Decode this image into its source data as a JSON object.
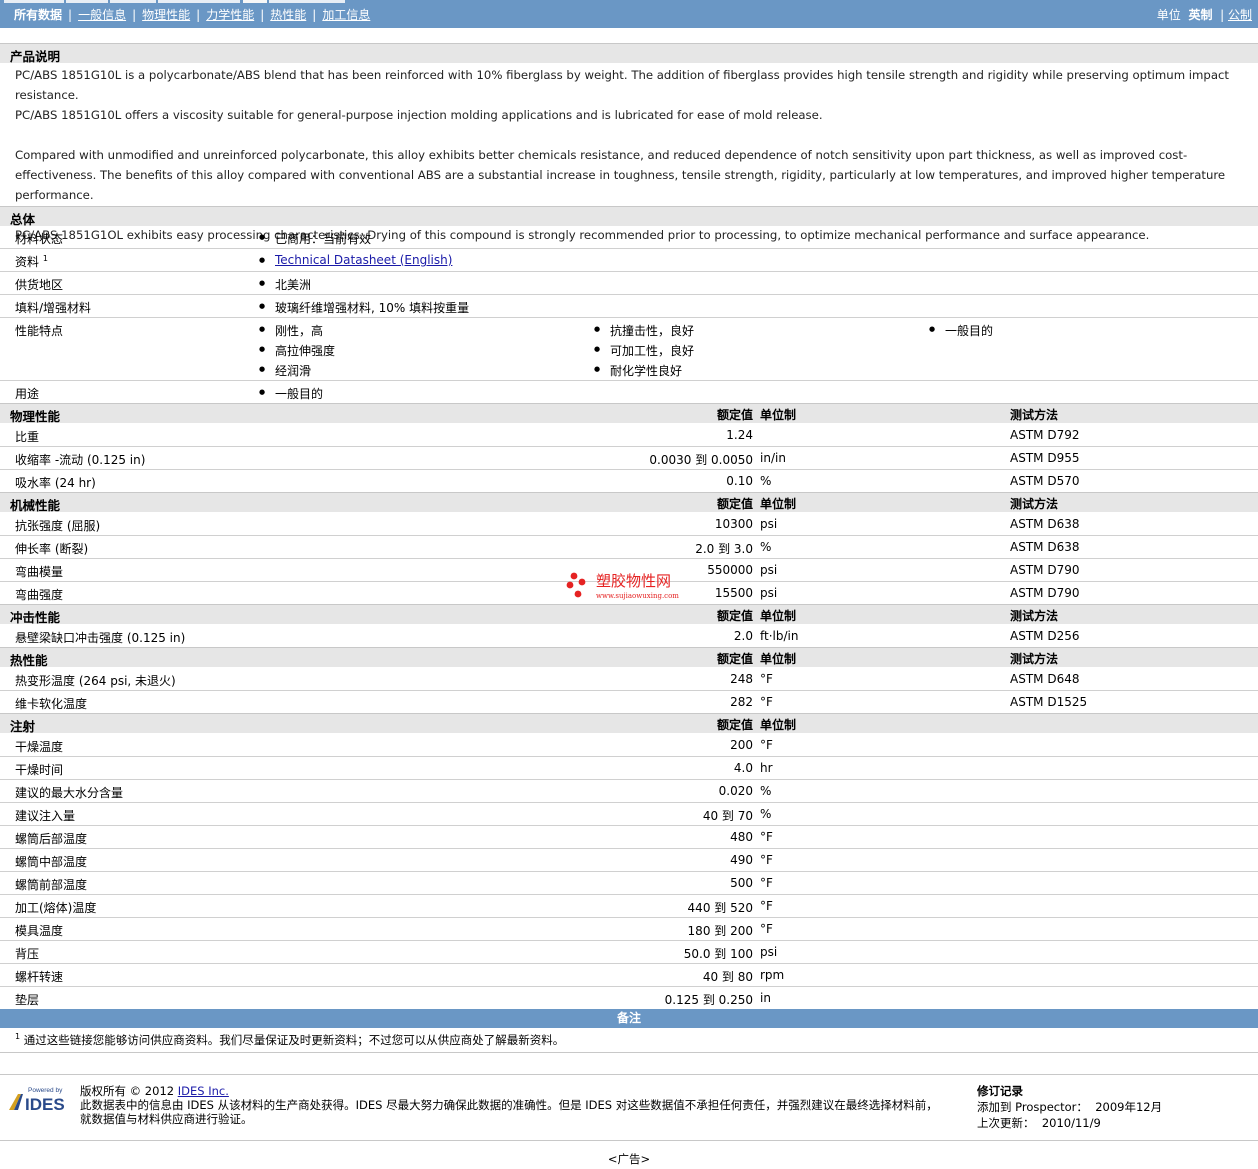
{
  "nav": {
    "all_data": "所有数据",
    "links": [
      "一般信息",
      "物理性能",
      "力学性能",
      "热性能",
      "加工信息"
    ]
  },
  "units": {
    "label": "单位",
    "english": "英制",
    "metric": "公制"
  },
  "description": {
    "title": "产品说明",
    "p1": "PC/ABS 1851G10L is a polycarbonate/ABS blend that has been reinforced with 10% fiberglass by weight. The addition of fiberglass provides high tensile strength and rigidity while preserving optimum impact resistance.",
    "p2": "PC/ABS 1851G10L offers a viscosity suitable for general-purpose injection molding applications and is lubricated for ease of mold release.",
    "p3": "Compared with unmodified and unreinforced polycarbonate, this alloy exhibits better chemicals resistance, and reduced dependence of notch sensitivity upon part thickness, as well as improved cost-effectiveness. The benefits of this alloy compared with conventional ABS are a substantial increase in toughness, tensile strength, rigidity, particularly at low temperatures, and improved higher temperature performance.",
    "p4": "PC/ABS 1851G1OL exhibits easy processing characteristics. Drying of this compound is strongly recommended prior to processing, to optimize mechanical performance and surface appearance."
  },
  "general": {
    "title": "总体",
    "material_status_label": "材料状态",
    "material_status": "已商用：当前有效",
    "docs_label": "资料",
    "docs_sup": "1",
    "docs_link": "Technical Datasheet (English)",
    "region_label": "供货地区",
    "region": "北美洲",
    "filler_label": "填料/增强材料",
    "filler": "玻璃纤维增强材料, 10% 填料按重量",
    "features_label": "性能特点",
    "features": [
      "刚性，高",
      "高拉伸强度",
      "经润滑",
      "抗撞击性，良好",
      "可加工性，良好",
      "耐化学性良好",
      "一般目的"
    ],
    "uses_label": "用途",
    "uses": "一般目的"
  },
  "headers": {
    "nominal": "额定值",
    "unit": "单位制",
    "method": "测试方法"
  },
  "physical": {
    "title": "物理性能",
    "rows": [
      {
        "label": "比重",
        "value": "1.24",
        "unit": "",
        "method": "ASTM D792"
      },
      {
        "label": "收缩率 -流动 (0.125 in)",
        "value": "0.0030 到 0.0050",
        "unit": "in/in",
        "method": "ASTM D955"
      },
      {
        "label": "吸水率 (24 hr)",
        "value": "0.10",
        "unit": "%",
        "method": "ASTM D570"
      }
    ]
  },
  "mechanical": {
    "title": "机械性能",
    "rows": [
      {
        "label": "抗张强度 (屈服)",
        "value": "10300",
        "unit": "psi",
        "method": "ASTM D638"
      },
      {
        "label": "伸长率 (断裂)",
        "value": "2.0 到 3.0",
        "unit": "%",
        "method": "ASTM D638"
      },
      {
        "label": "弯曲模量",
        "value": "550000",
        "unit": "psi",
        "method": "ASTM D790"
      },
      {
        "label": "弯曲强度",
        "value": "15500",
        "unit": "psi",
        "method": "ASTM D790"
      }
    ]
  },
  "impact": {
    "title": "冲击性能",
    "rows": [
      {
        "label": "悬壁梁缺口冲击强度 (0.125 in)",
        "value": "2.0",
        "unit": "ft·lb/in",
        "method": "ASTM D256"
      }
    ]
  },
  "thermal": {
    "title": "热性能",
    "rows": [
      {
        "label": "热变形温度 (264 psi, 未退火)",
        "value": "248",
        "unit": "°F",
        "method": "ASTM D648"
      },
      {
        "label": "维卡软化温度",
        "value": "282",
        "unit": "°F",
        "method": "ASTM D1525"
      }
    ]
  },
  "injection": {
    "title": "注射",
    "rows": [
      {
        "label": "干燥温度",
        "value": "200",
        "unit": "°F"
      },
      {
        "label": "干燥时间",
        "value": "4.0",
        "unit": "hr"
      },
      {
        "label": "建议的最大水分含量",
        "value": "0.020",
        "unit": "%"
      },
      {
        "label": "建议注入量",
        "value": "40 到 70",
        "unit": "%"
      },
      {
        "label": "螺筒后部温度",
        "value": "480",
        "unit": "°F"
      },
      {
        "label": "螺筒中部温度",
        "value": "490",
        "unit": "°F"
      },
      {
        "label": "螺筒前部温度",
        "value": "500",
        "unit": "°F"
      },
      {
        "label": "加工(熔体)温度",
        "value": "440 到 520",
        "unit": "°F"
      },
      {
        "label": "模具温度",
        "value": "180 到 200",
        "unit": "°F"
      },
      {
        "label": "背压",
        "value": "50.0 到 100",
        "unit": "psi"
      },
      {
        "label": "螺杆转速",
        "value": "40 到 80",
        "unit": "rpm"
      },
      {
        "label": "垫层",
        "value": "0.125 到 0.250",
        "unit": "in"
      }
    ]
  },
  "notes": {
    "title": "备注",
    "sup": "1",
    "text": "通过这些链接您能够访问供应商资料。我们尽量保证及时更新资料；不过您可以从供应商处了解最新资料。"
  },
  "footer": {
    "logo_top": "Powered by",
    "logo_text": "IDES",
    "copyright_prefix": "版权所有 © 2012 ",
    "copyright_link": "IDES Inc.",
    "disclaimer1": "此数据表中的信息由 IDES 从该材料的生产商处获得。IDES 尽最大努力确保此数据的准确性。但是 IDES 对这些数据值不承担任何责任，并强烈建议在最终选择材料前，",
    "disclaimer2": "就数据值与材料供应商进行验证。",
    "rev_title": "修订记录",
    "added_label": "添加到 Prospector：",
    "added_value": "2009年12月",
    "updated_label": "上次更新：",
    "updated_value": "2010/11/9",
    "ad": "<广告>"
  },
  "watermark": {
    "text": "塑胶物性网",
    "url": "www.sujiaowuxing.com",
    "color": "#e52222"
  }
}
